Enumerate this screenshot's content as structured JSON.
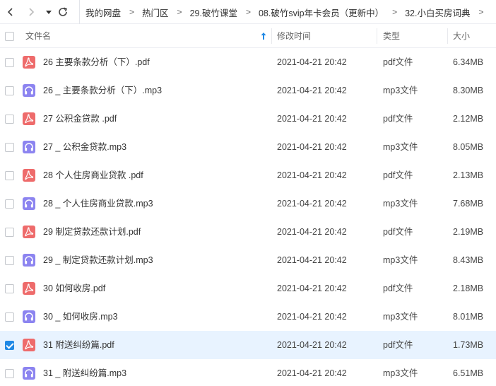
{
  "nav": {
    "breadcrumbs": [
      "我的网盘",
      "热门区",
      "29.破竹课堂",
      "08.破竹svip年卡会员（更新中）",
      "32.小白买房词典"
    ],
    "separator": ">"
  },
  "columns": {
    "name": "文件名",
    "modified": "修改时间",
    "type": "类型",
    "size": "大小"
  },
  "files": [
    {
      "name": "26  主要条款分析（下）.pdf",
      "modified": "2021-04-21 20:42",
      "type": "pdf文件",
      "size": "6.34MB",
      "icon": "pdf-file-icon",
      "selected": false
    },
    {
      "name": "26 _ 主要条款分析（下）.mp3",
      "modified": "2021-04-21 20:42",
      "type": "mp3文件",
      "size": "8.30MB",
      "icon": "audio-file-icon",
      "selected": false
    },
    {
      "name": "27  公积金贷款 .pdf",
      "modified": "2021-04-21 20:42",
      "type": "pdf文件",
      "size": "2.12MB",
      "icon": "pdf-file-icon",
      "selected": false
    },
    {
      "name": "27 _ 公积金贷款.mp3",
      "modified": "2021-04-21 20:42",
      "type": "mp3文件",
      "size": "8.05MB",
      "icon": "audio-file-icon",
      "selected": false
    },
    {
      "name": "28  个人住房商业贷款 .pdf",
      "modified": "2021-04-21 20:42",
      "type": "pdf文件",
      "size": "2.13MB",
      "icon": "pdf-file-icon",
      "selected": false
    },
    {
      "name": "28 _ 个人住房商业贷款.mp3",
      "modified": "2021-04-21 20:42",
      "type": "mp3文件",
      "size": "7.68MB",
      "icon": "audio-file-icon",
      "selected": false
    },
    {
      "name": "29  制定贷款还款计划.pdf",
      "modified": "2021-04-21 20:42",
      "type": "pdf文件",
      "size": "2.19MB",
      "icon": "pdf-file-icon",
      "selected": false
    },
    {
      "name": "29 _ 制定贷款还款计划.mp3",
      "modified": "2021-04-21 20:42",
      "type": "mp3文件",
      "size": "8.43MB",
      "icon": "audio-file-icon",
      "selected": false
    },
    {
      "name": "30  如何收房.pdf",
      "modified": "2021-04-21 20:42",
      "type": "pdf文件",
      "size": "2.18MB",
      "icon": "pdf-file-icon",
      "selected": false
    },
    {
      "name": "30 _ 如何收房.mp3",
      "modified": "2021-04-21 20:42",
      "type": "mp3文件",
      "size": "8.01MB",
      "icon": "audio-file-icon",
      "selected": false
    },
    {
      "name": "31  附送纠纷篇.pdf",
      "modified": "2021-04-21 20:42",
      "type": "pdf文件",
      "size": "1.73MB",
      "icon": "pdf-file-icon",
      "selected": true
    },
    {
      "name": "31 _ 附送纠纷篇.mp3",
      "modified": "2021-04-21 20:42",
      "type": "mp3文件",
      "size": "6.51MB",
      "icon": "audio-file-icon",
      "selected": false
    }
  ],
  "colors": {
    "accent": "#1e88e5",
    "selected_row": "#e8f3ff",
    "pdf_icon": "#ee6b6b",
    "audio_icon": "#8c84f0"
  }
}
